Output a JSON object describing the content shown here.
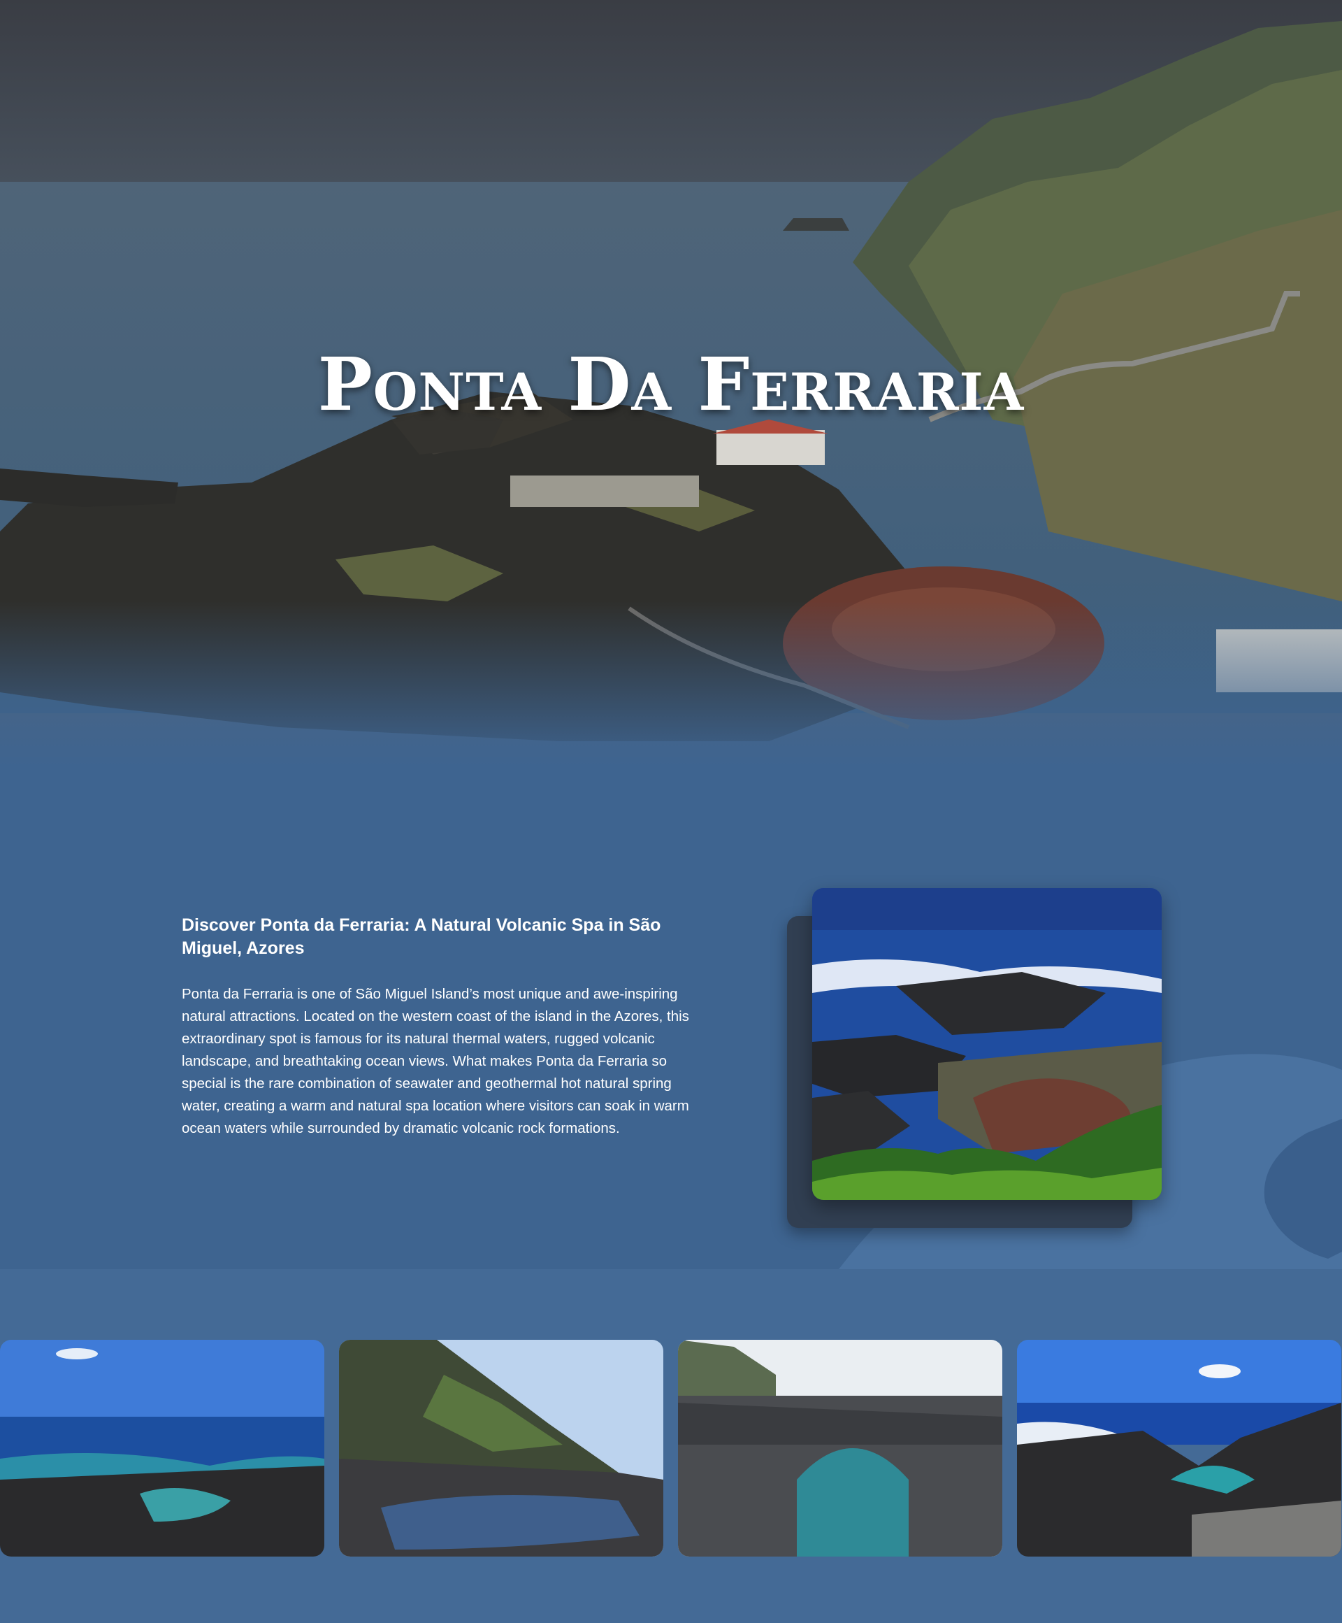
{
  "hero": {
    "title": "Ponta Da Ferraria",
    "image": "coastline-aerial-photo"
  },
  "intro": {
    "heading": "Discover Ponta da Ferraria: A Natural Volcanic Spa in São Miguel, Azores",
    "body": "Ponta da Ferraria is one of São Miguel Island’s most unique and awe-inspiring natural attractions. Located on the western coast of the island in the Azores, this extraordinary spot is famous for its natural thermal waters, rugged volcanic landscape, and breathtaking ocean views. What makes Ponta da Ferraria so special is the rare combination of seawater and geothermal hot natural spring water, creating a warm and natural spa location where visitors can soak in warm ocean waters while surrounded by dramatic volcanic rock formations.",
    "image": "coastal-lava-rocks-photo"
  },
  "gallery": {
    "images": [
      "rock-pools-photo",
      "bathers-cove-photo",
      "lava-arch-photo",
      "rocky-shore-photo"
    ]
  },
  "colors": {
    "section_bg": "#3e6490",
    "gallery_bg": "#446a96",
    "text": "#ffffff"
  }
}
